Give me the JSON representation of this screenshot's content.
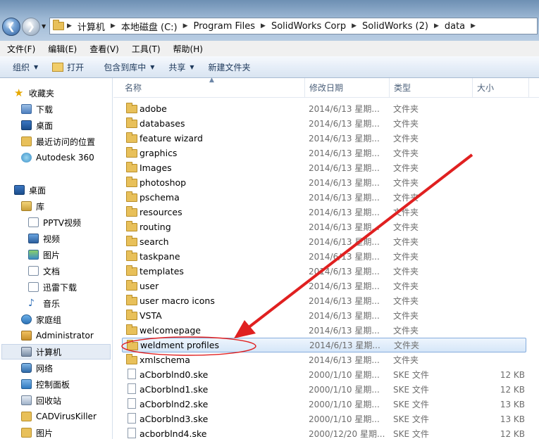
{
  "address": {
    "crumbs": [
      "计算机",
      "本地磁盘 (C:)",
      "Program Files",
      "SolidWorks Corp",
      "SolidWorks (2)",
      "data"
    ]
  },
  "menu": [
    "文件(F)",
    "编辑(E)",
    "查看(V)",
    "工具(T)",
    "帮助(H)"
  ],
  "toolbar": {
    "organize": "组织",
    "open": "打开",
    "include_in_library": "包含到库中",
    "share": "共享",
    "new_folder": "新建文件夹"
  },
  "nav": {
    "favorites": "收藏夹",
    "downloads": "下载",
    "desktop_fav": "桌面",
    "recent": "最近访问的位置",
    "autodesk": "Autodesk 360",
    "desktop": "桌面",
    "libraries": "库",
    "pptv": "PPTV视频",
    "videos": "视频",
    "pictures": "图片",
    "documents": "文档",
    "xunlei": "迅雷下载",
    "music": "音乐",
    "homegroup": "家庭组",
    "administrator": "Administrator",
    "computer": "计算机",
    "network": "网络",
    "control_panel": "控制面板",
    "recycle_bin": "回收站",
    "cadviruskiller": "CADVirusKiller",
    "pictures2": "图片"
  },
  "columns": {
    "name": "名称",
    "date": "修改日期",
    "type": "类型",
    "size": "大小"
  },
  "files": [
    {
      "name": "adobe",
      "date": "2014/6/13 星期...",
      "type": "文件夹",
      "size": "",
      "kind": "folder"
    },
    {
      "name": "databases",
      "date": "2014/6/13 星期...",
      "type": "文件夹",
      "size": "",
      "kind": "folder"
    },
    {
      "name": "feature wizard",
      "date": "2014/6/13 星期...",
      "type": "文件夹",
      "size": "",
      "kind": "folder"
    },
    {
      "name": "graphics",
      "date": "2014/6/13 星期...",
      "type": "文件夹",
      "size": "",
      "kind": "folder"
    },
    {
      "name": "Images",
      "date": "2014/6/13 星期...",
      "type": "文件夹",
      "size": "",
      "kind": "folder"
    },
    {
      "name": "photoshop",
      "date": "2014/6/13 星期...",
      "type": "文件夹",
      "size": "",
      "kind": "folder"
    },
    {
      "name": "pschema",
      "date": "2014/6/13 星期...",
      "type": "文件夹",
      "size": "",
      "kind": "folder"
    },
    {
      "name": "resources",
      "date": "2014/6/13 星期...",
      "type": "文件夹",
      "size": "",
      "kind": "folder"
    },
    {
      "name": "routing",
      "date": "2014/6/13 星期...",
      "type": "文件夹",
      "size": "",
      "kind": "folder"
    },
    {
      "name": "search",
      "date": "2014/6/13 星期...",
      "type": "文件夹",
      "size": "",
      "kind": "folder"
    },
    {
      "name": "taskpane",
      "date": "2014/6/13 星期...",
      "type": "文件夹",
      "size": "",
      "kind": "folder"
    },
    {
      "name": "templates",
      "date": "2014/6/13 星期...",
      "type": "文件夹",
      "size": "",
      "kind": "folder"
    },
    {
      "name": "user",
      "date": "2014/6/13 星期...",
      "type": "文件夹",
      "size": "",
      "kind": "folder"
    },
    {
      "name": "user macro icons",
      "date": "2014/6/13 星期...",
      "type": "文件夹",
      "size": "",
      "kind": "folder"
    },
    {
      "name": "VSTA",
      "date": "2014/6/13 星期...",
      "type": "文件夹",
      "size": "",
      "kind": "folder"
    },
    {
      "name": "welcomepage",
      "date": "2014/6/13 星期...",
      "type": "文件夹",
      "size": "",
      "kind": "folder"
    },
    {
      "name": "weldment profiles",
      "date": "2014/6/13 星期...",
      "type": "文件夹",
      "size": "",
      "kind": "folder",
      "selected": true
    },
    {
      "name": "xmlschema",
      "date": "2014/6/13 星期...",
      "type": "文件夹",
      "size": "",
      "kind": "folder"
    },
    {
      "name": "aCborblnd0.ske",
      "date": "2000/1/10 星期...",
      "type": "SKE 文件",
      "size": "12 KB",
      "kind": "file"
    },
    {
      "name": "aCborblnd1.ske",
      "date": "2000/1/10 星期...",
      "type": "SKE 文件",
      "size": "12 KB",
      "kind": "file"
    },
    {
      "name": "aCborblnd2.ske",
      "date": "2000/1/10 星期...",
      "type": "SKE 文件",
      "size": "13 KB",
      "kind": "file"
    },
    {
      "name": "aCborblnd3.ske",
      "date": "2000/1/10 星期...",
      "type": "SKE 文件",
      "size": "13 KB",
      "kind": "file"
    },
    {
      "name": "acborblnd4.ske",
      "date": "2000/12/20 星期...",
      "type": "SKE 文件",
      "size": "12 KB",
      "kind": "file"
    }
  ],
  "colors": {
    "annotation": "#e02020",
    "selection_border": "#84acdd"
  }
}
